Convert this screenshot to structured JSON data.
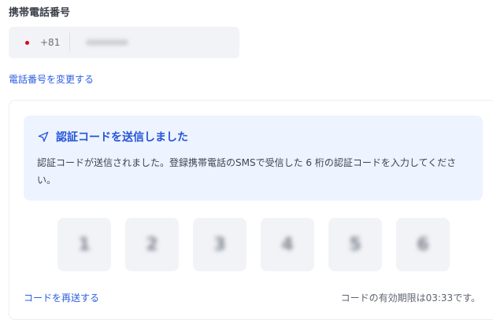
{
  "phone": {
    "label": "携帯電話番号",
    "country_code": "+81",
    "flag_color": "#e0001a",
    "number_blurred": true
  },
  "change_link": "電話番号を変更する",
  "notice": {
    "icon": "send-icon",
    "title": "認証コードを送信しました",
    "body": "認証コードが送信されました。登録携帯電話のSMSで受信した 6 桁の認証コードを入力してください。"
  },
  "code_digits": [
    "1",
    "2",
    "3",
    "4",
    "5",
    "6"
  ],
  "resend_link": "コードを再送する",
  "expiry": "コードの有効期限は03:33です。",
  "colors": {
    "accent": "#2454d8",
    "link": "#2b5ee3",
    "notice_bg": "#edf3ff",
    "field_bg": "#f2f3f6"
  }
}
